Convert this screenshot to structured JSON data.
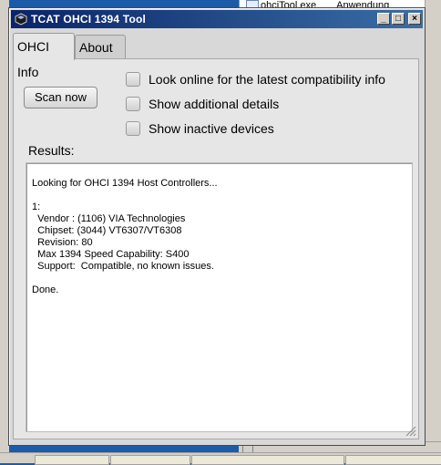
{
  "background": {
    "file_name": "ohciTool.exe",
    "file_type": "Anwendung"
  },
  "window": {
    "title": "TCAT OHCI 1394 Tool",
    "controls": {
      "minimize": "_",
      "maximize": "□",
      "close": "×"
    }
  },
  "tabs": [
    {
      "label": "OHCI Info",
      "active": true
    },
    {
      "label": "About",
      "active": false
    }
  ],
  "main": {
    "scan_button": "Scan now",
    "options": [
      {
        "label": "Look online for the latest compatibility info",
        "checked": false
      },
      {
        "label": "Show additional details",
        "checked": false
      },
      {
        "label": "Show inactive devices",
        "checked": false
      }
    ],
    "results_label": "Results:",
    "results_text": "Looking for OHCI 1394 Host Controllers...\n\n1:\n  Vendor : (1106) VIA Technologies\n  Chipset: (3044) VT6307/VT6308\n  Revision: 80\n  Max 1394 Speed Capability: S400\n  Support:  Compatible, no known issues.\n\nDone."
  },
  "colors": {
    "titlebar_start": "#0a246a",
    "titlebar_end": "#3a6ea5",
    "desktop": "#1c5ba8"
  }
}
